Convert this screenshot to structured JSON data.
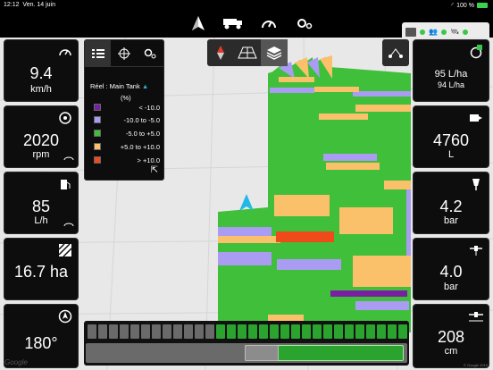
{
  "status_bar": {
    "time": "12:12",
    "date": "Ven. 14 juin",
    "battery": "100 %"
  },
  "nav": {
    "items": [
      "guidance",
      "machine",
      "dashboard",
      "settings"
    ],
    "active": "guidance"
  },
  "tiles_left": [
    {
      "value": "9.4",
      "unit": "km/h",
      "icon": "speedometer-icon"
    },
    {
      "value": "2020",
      "unit": "rpm",
      "icon": "pto-rpm-icon"
    },
    {
      "value": "85",
      "unit": "L/h",
      "icon": "fuel-pump-icon"
    },
    {
      "value": "16.7 ha",
      "unit": "",
      "icon": "area-hatch-icon"
    },
    {
      "value": "180°",
      "unit": "",
      "icon": "compass-heading-icon"
    }
  ],
  "tiles_right": [
    {
      "value": "95 L/ha",
      "unit": "94 L/ha",
      "icon": "target-rate-icon"
    },
    {
      "value": "4760",
      "unit": "L",
      "icon": "tank-icon"
    },
    {
      "value": "4.2",
      "unit": "bar",
      "icon": "pressure-icon"
    },
    {
      "value": "4.0",
      "unit": "bar",
      "icon": "boom-pressure-icon"
    },
    {
      "value": "208",
      "unit": "cm",
      "icon": "boom-height-icon"
    }
  ],
  "legend": {
    "title": "Réel : Main Tank",
    "unit": "(%)",
    "items": [
      {
        "label": "< -10.0",
        "color": "#7b1fa2"
      },
      {
        "label": "-10.0 to -5.0",
        "color": "#a99cf2"
      },
      {
        "label": "-5.0 to +5.0",
        "color": "#3fbf3a"
      },
      {
        "label": "+5.0 to +10.0",
        "color": "#fbc06a"
      },
      {
        "label": "> +10.0",
        "color": "#ef4a1a"
      }
    ]
  },
  "map_attribution": {
    "logo": "Google",
    "copyright": "© Google 2019"
  },
  "colors": {
    "accent_red": "#e23a2a",
    "applied_green": "#3fbf3a",
    "section_on": "#2aa32f"
  },
  "boom": {
    "sections_total": 30,
    "sections_on_from": 12
  }
}
